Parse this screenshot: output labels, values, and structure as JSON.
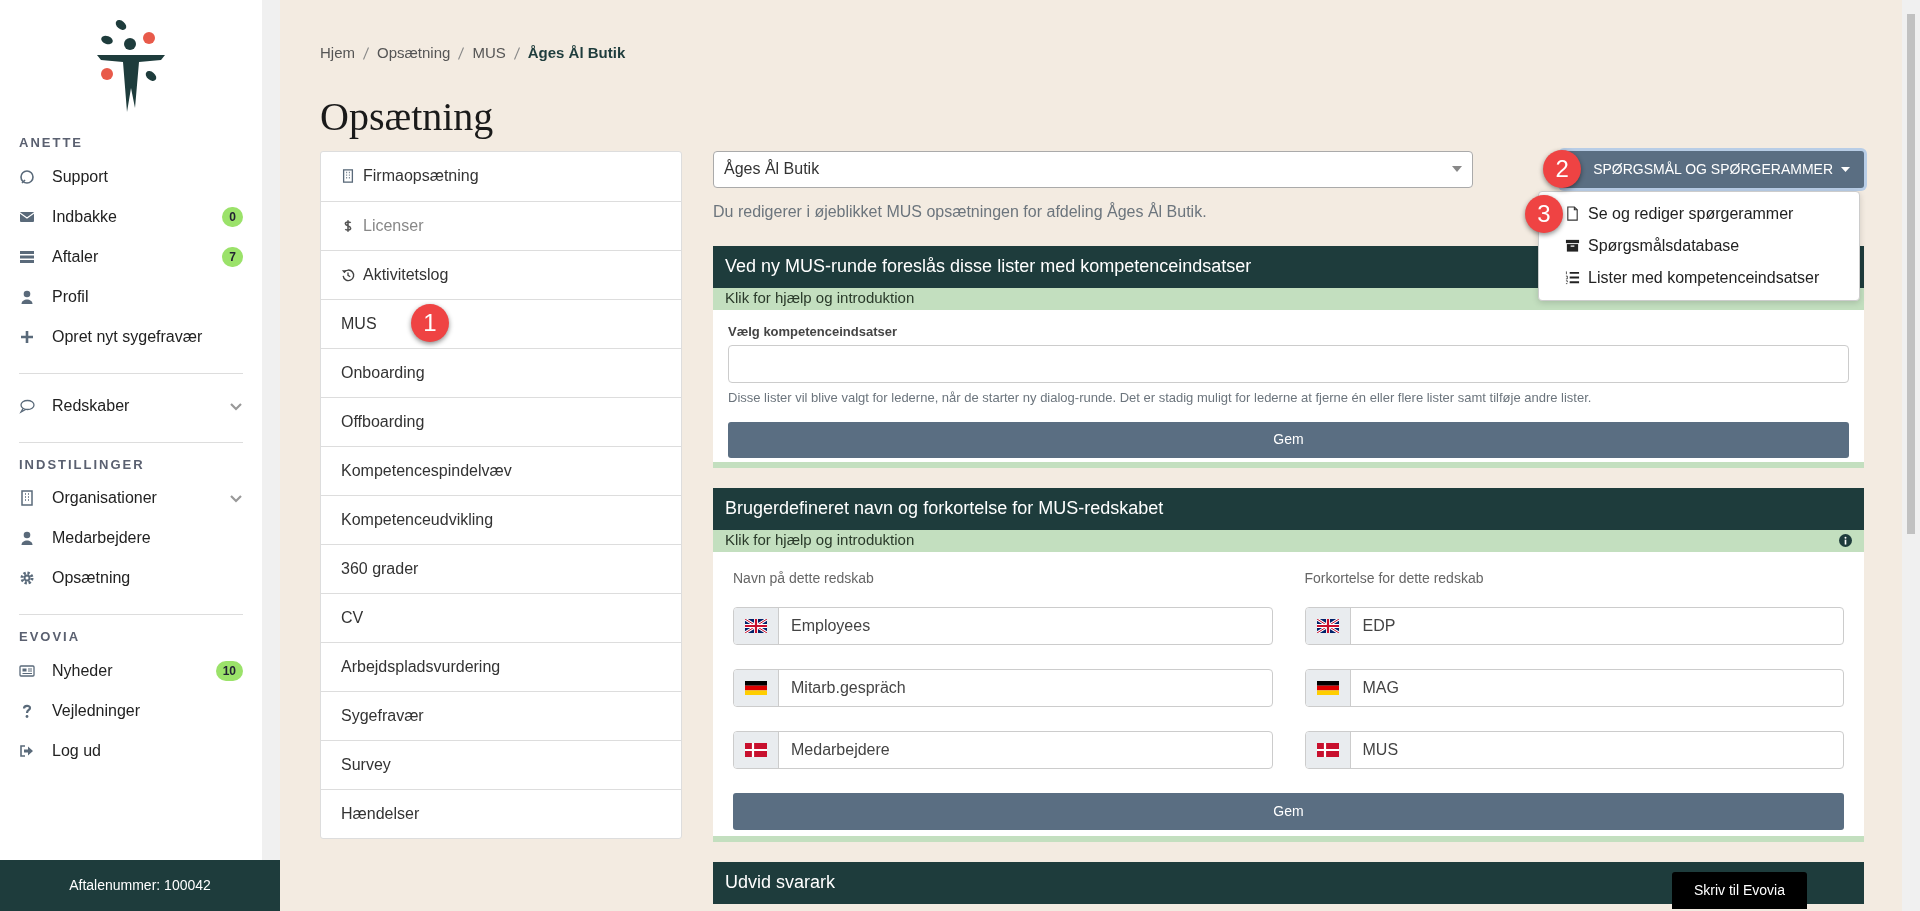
{
  "sidebar": {
    "sections": [
      {
        "heading": "ANETTE",
        "items": [
          {
            "label": "Support",
            "expandable": false
          },
          {
            "label": "Indbakke",
            "badge": "0",
            "expandable": false
          },
          {
            "label": "Aftaler",
            "badge": "7",
            "expandable": false
          },
          {
            "label": "Profil",
            "expandable": false
          },
          {
            "label": "Opret nyt sygefravær",
            "expandable": false
          }
        ]
      },
      {
        "items": [
          {
            "label": "Redskaber",
            "expandable": true
          }
        ]
      },
      {
        "heading": "INDSTILLINGER",
        "items": [
          {
            "label": "Organisationer",
            "expandable": true
          },
          {
            "label": "Medarbejdere",
            "expandable": false
          },
          {
            "label": "Opsætning",
            "expandable": false
          }
        ]
      },
      {
        "heading": "EVOVIA",
        "items": [
          {
            "label": "Nyheder",
            "badge": "10",
            "expandable": false
          },
          {
            "label": "Vejledninger",
            "expandable": false
          },
          {
            "label": "Log ud",
            "expandable": false
          }
        ]
      }
    ],
    "footer": "Aftalenummer: 100042"
  },
  "breadcrumb": [
    "Hjem",
    "Opsætning",
    "MUS",
    "Åges Ål Butik"
  ],
  "title": "Opsætning",
  "settings_menu": [
    {
      "label": "Firmaopsætning",
      "disabled": false
    },
    {
      "label": "Licenser",
      "disabled": true
    },
    {
      "label": "Aktivitetslog",
      "disabled": false
    },
    {
      "label": "MUS",
      "disabled": false,
      "marker": "1"
    },
    {
      "label": "Onboarding",
      "disabled": false
    },
    {
      "label": "Offboarding",
      "disabled": false
    },
    {
      "label": "Kompetencespindelvæv",
      "disabled": false
    },
    {
      "label": "Kompetenceudvikling",
      "disabled": false
    },
    {
      "label": "360 grader",
      "disabled": false
    },
    {
      "label": "CV",
      "disabled": false
    },
    {
      "label": "Arbejdspladsvurdering",
      "disabled": false
    },
    {
      "label": "Sygefravær",
      "disabled": false
    },
    {
      "label": "Survey",
      "disabled": false
    },
    {
      "label": "Hændelser",
      "disabled": false
    }
  ],
  "department_select": {
    "value": "Åges Ål Butik",
    "note": "Du redigerer i øjeblikket MUS opsætningen for afdeling Åges Ål Butik."
  },
  "questions_dropdown": {
    "label": "SPØRGSMÅL OG SPØRGERAMMER",
    "marker": "2",
    "expanded": true,
    "items": [
      {
        "label": "Se og rediger spørgerammer",
        "marker": "3"
      },
      {
        "label": "Spørgsmålsdatabase"
      },
      {
        "label": "Lister med kompetenceindsatser"
      }
    ]
  },
  "panels": [
    {
      "kind": "competence",
      "title": "Ved ny MUS-runde foreslås disse lister med kompetenceindsatser",
      "help": "Klik for hjælp og introduktion",
      "field_label": "Vælg kompetenceindsatser",
      "hint": "Disse lister vil blive valgt for lederne, når de starter ny dialog-runde. Det er stadig muligt for lederne at fjerne én eller flere lister samt tilføje andre lister.",
      "button": "Gem"
    },
    {
      "kind": "names",
      "title": "Brugerdefineret navn og forkortelse for MUS-redskabet",
      "help": "Klik for hjælp og introduktion",
      "name_label": "Navn på dette redskab",
      "abbr_label": "Forkortelse for dette redskab",
      "rows": [
        {
          "name": "Employees",
          "abbr": "EDP"
        },
        {
          "name": "Mitarb.gespräch",
          "abbr": "MAG"
        },
        {
          "name": "Medarbejdere",
          "abbr": "MUS"
        }
      ],
      "button": "Gem"
    },
    {
      "kind": "collapsed",
      "title": "Udvid svarark"
    }
  ],
  "chat_button": "Skriv til Evovia"
}
